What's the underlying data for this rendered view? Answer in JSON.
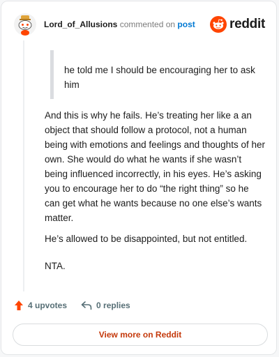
{
  "header": {
    "username": "Lord_of_Allusions",
    "action_text": "commented on",
    "target_link": "post",
    "brand_name": "reddit",
    "brand_color": "#ff4500"
  },
  "comment": {
    "quote": "he told me I should be encouraging her to ask him",
    "paragraphs": [
      "And this is why he fails. He’s treating her like a an object that should follow a protocol, not a human being with emotions and feelings and thoughts of her own. She would do what he wants if she wasn’t being influenced incorrectly, in his eyes. He’s asking you to encourage her to do “the right thing” so he can get what he wants because no one else’s wants matter.",
      "He’s allowed to be disappointed, but not entitled.",
      "NTA."
    ]
  },
  "actions": {
    "upvotes": "4 upvotes",
    "replies": "0 replies",
    "upvote_icon_color": "#ff4500"
  },
  "footer": {
    "view_more": "View more on Reddit",
    "view_more_color": "#c4380a"
  },
  "icons": {
    "avatar": "snoo-avatar-icon",
    "brand": "reddit-logo-icon",
    "upvote": "upvote-arrow-icon",
    "reply": "reply-arrow-icon"
  }
}
